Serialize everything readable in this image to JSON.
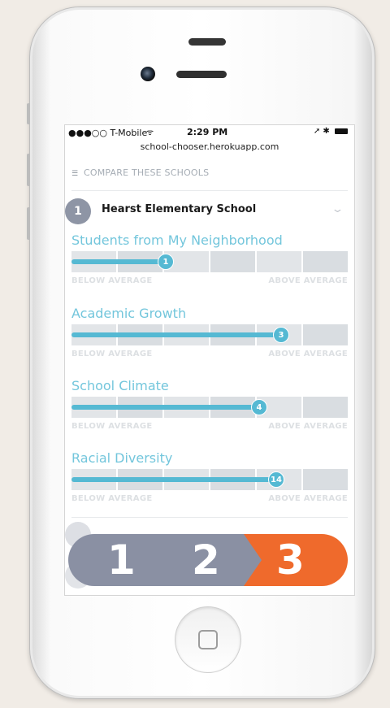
{
  "status_bar": {
    "carrier": "●●●○○ T-Mobile",
    "wifi_icon": "wifi-icon",
    "time": "2:29 PM",
    "right_icons": "➚ ✱"
  },
  "browser": {
    "url": "school-chooser.herokuapp.com"
  },
  "compare_header": {
    "label": "COMPARE THESE SCHOOLS"
  },
  "school": {
    "number": "1",
    "name": "Hearst Elementary School"
  },
  "metrics": [
    {
      "label": "Students from My Neighborhood",
      "value": "1",
      "level": 0.34,
      "below_label": "BELOW AVERAGE",
      "above_label": "ABOVE AVERAGE"
    },
    {
      "label": "Academic Growth",
      "value": "3",
      "level": 0.76,
      "below_label": "BELOW AVERAGE",
      "above_label": "ABOVE AVERAGE"
    },
    {
      "label": "School Climate",
      "value": "4",
      "level": 0.68,
      "below_label": "BELOW AVERAGE",
      "above_label": "ABOVE AVERAGE"
    },
    {
      "label": "Racial Diversity",
      "value": "14",
      "level": 0.74,
      "below_label": "BELOW AVERAGE",
      "above_label": "ABOVE AVERAGE"
    }
  ],
  "steps": [
    {
      "label": "1",
      "color": "#8a90a3"
    },
    {
      "label": "2",
      "color": "#8a90a3"
    },
    {
      "label": "3",
      "color": "#ef6a2c"
    }
  ],
  "colors": {
    "accent": "#55b9d3",
    "label": "#73c6dc",
    "step_gray": "#8a90a3",
    "step_orange": "#ef6a2c"
  }
}
